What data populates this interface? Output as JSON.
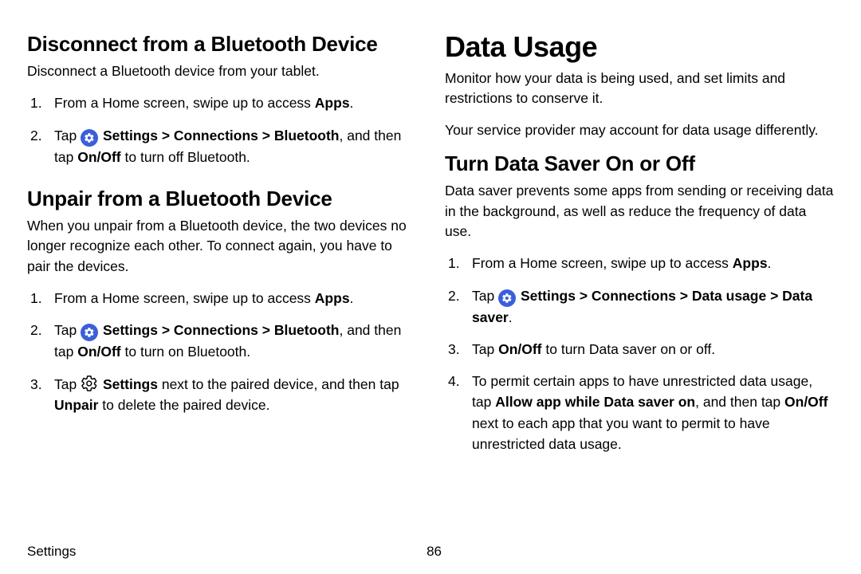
{
  "left": {
    "sec1": {
      "heading": "Disconnect from a Bluetooth Device",
      "intro": "Disconnect a Bluetooth device from your tablet.",
      "step1_a": "From a Home screen, swipe up to access ",
      "step1_b": "Apps",
      "step1_c": ".",
      "step2_a": "Tap ",
      "step2_b": " Settings > Connections > Bluetooth",
      "step2_c": ", and then tap ",
      "step2_d": "On/Off",
      "step2_e": " to turn off Bluetooth."
    },
    "sec2": {
      "heading": "Unpair from a Bluetooth Device",
      "intro": "When you unpair from a Bluetooth device, the two devices no longer recognize each other. To connect again, you have to pair the devices.",
      "step1_a": "From a Home screen, swipe up to access ",
      "step1_b": "Apps",
      "step1_c": ".",
      "step2_a": "Tap ",
      "step2_b": " Settings > Connections > Bluetooth",
      "step2_c": ", and then tap ",
      "step2_d": "On/Off",
      "step2_e": " to turn on Bluetooth.",
      "step3_a": "Tap ",
      "step3_b": " Settings",
      "step3_c": " next to the paired device, and then tap ",
      "step3_d": "Unpair",
      "step3_e": " to delete the paired device."
    }
  },
  "right": {
    "title": "Data Usage",
    "intro1": "Monitor how your data is being used, and set limits and restrictions to conserve it.",
    "intro2": "Your service provider may account for data usage differently.",
    "sec1": {
      "heading": "Turn Data Saver On or Off",
      "intro": "Data saver prevents some apps from sending or receiving data in the background, as well as reduce the frequency of data use.",
      "step1_a": "From a Home screen, swipe up to access ",
      "step1_b": "Apps",
      "step1_c": ".",
      "step2_a": "Tap ",
      "step2_b": " Settings > Connections > Data usage > Data saver",
      "step2_c": ".",
      "step3_a": "Tap ",
      "step3_b": "On/Off",
      "step3_c": " to turn Data saver on or off.",
      "step4_a": "To permit certain apps to have unrestricted data usage, tap ",
      "step4_b": "Allow app while Data saver on",
      "step4_c": ", and then tap ",
      "step4_d": "On/Off",
      "step4_e": " next to each app that you want to permit to have unrestricted data usage."
    }
  },
  "footer": {
    "section": "Settings",
    "page": "86"
  }
}
